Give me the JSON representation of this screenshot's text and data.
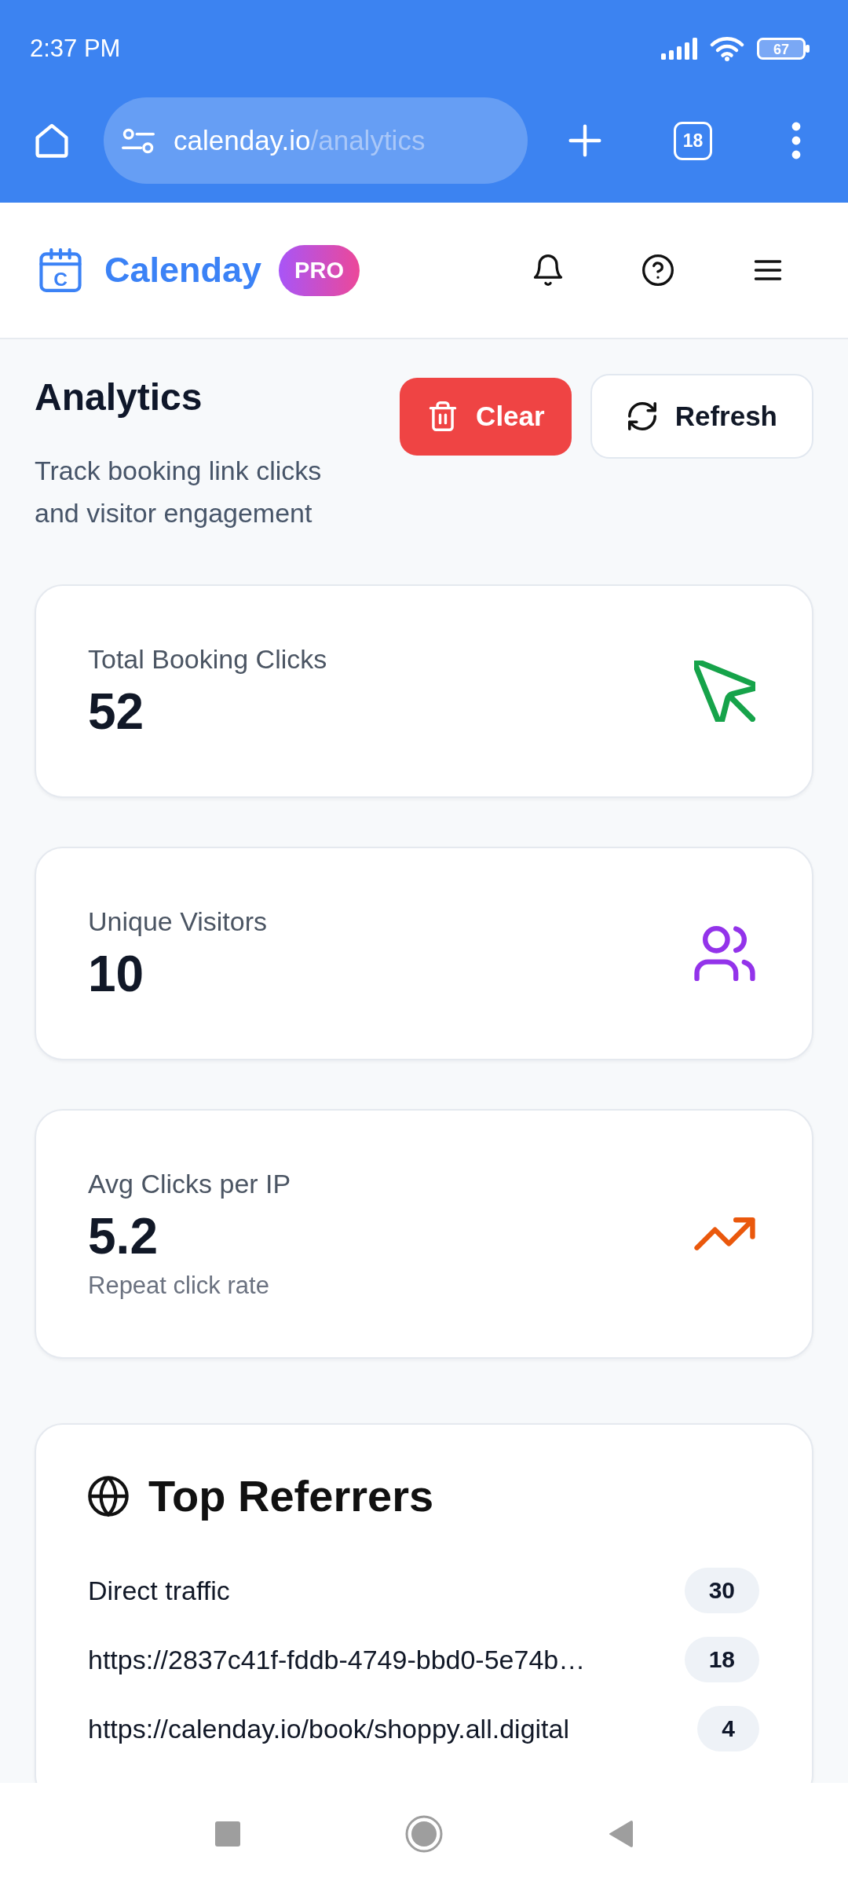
{
  "status_bar": {
    "time": "2:37 PM",
    "battery": "67"
  },
  "browser": {
    "url_host": "calenday.io",
    "url_path": "/analytics",
    "tab_count": "18"
  },
  "header": {
    "logo_letter": "C",
    "brand": "Calenday",
    "badge": "PRO"
  },
  "page": {
    "title": "Analytics",
    "subtitle": "Track booking link clicks and visitor engagement",
    "buttons": [
      {
        "label": "Clear",
        "kind": "danger"
      },
      {
        "label": "Refresh",
        "kind": "secondary"
      }
    ]
  },
  "stats": [
    {
      "label": "Total Booking Clicks",
      "value": "52",
      "kind": "pointer",
      "color": "#16a34a"
    },
    {
      "label": "Unique Visitors",
      "value": "10",
      "kind": "users",
      "color": "#9333ea"
    },
    {
      "label": "Avg Clicks per IP",
      "value": "5.2",
      "note": "Repeat click rate",
      "kind": "trend",
      "color": "#ea580c"
    }
  ],
  "referrers": {
    "title": "Top Referrers",
    "rows": [
      {
        "source": "Direct traffic",
        "count": "30"
      },
      {
        "source": "https://2837c41f-fddb-4749-bbd0-5e74b…",
        "count": "18"
      },
      {
        "source": "https://calenday.io/book/shoppy.all.digital",
        "count": "4"
      }
    ]
  }
}
